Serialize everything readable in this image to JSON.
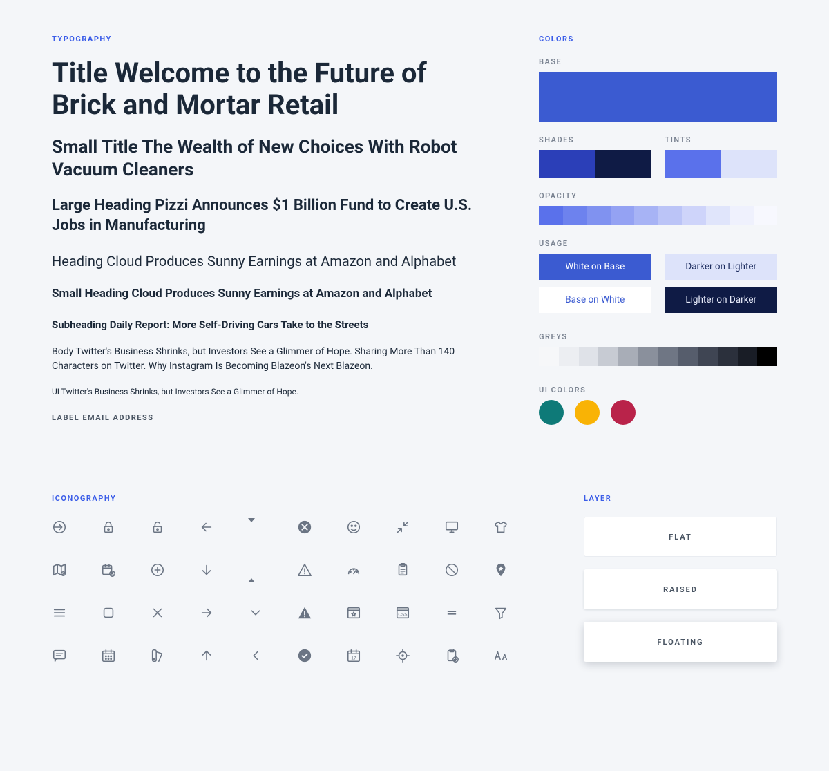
{
  "sections": {
    "typography": "TYPOGRAPHY",
    "colors": "COLORS",
    "iconography": "ICONOGRAPHY",
    "layer": "LAYER"
  },
  "typography": {
    "title": "Title Welcome to the Future of Brick and Mortar Retail",
    "stitle": "Small Title The Wealth of New Choices With Robot Vacuum Cleaners",
    "lhead": "Large Heading Pizzi Announces $1 Billion Fund to Create U.S. Jobs in Manufacturing",
    "head": "Heading Cloud Produces Sunny Earnings at Amazon and Alphabet",
    "shead": "Small Heading Cloud Produces Sunny Earnings at Amazon and Alphabet",
    "subhead": "Subheading Daily Report: More Self-Driving Cars Take to the Streets",
    "body": "Body Twitter's Business Shrinks, but Investors See a Glimmer of Hope. Sharing More Than 140 Characters on Twitter. Why Instagram Is Becoming Blazeon's Next Blazeon.",
    "ui": "UI Twitter's Business Shrinks, but Investors See a Glimmer of Hope.",
    "label": "LABEL EMAIL ADDRESS"
  },
  "colors": {
    "base_label": "BASE",
    "base": "#3b5bd1",
    "shades_label": "SHADES",
    "shades": [
      "#2b3fb8",
      "#0f1b45"
    ],
    "tints_label": "TINTS",
    "tints": [
      "#5a71eb",
      "#dde3fa"
    ],
    "opacity_label": "OPACITY",
    "opacity": [
      "#5a71eb",
      "#6d82ee",
      "#8092f0",
      "#94a2f3",
      "#a7b3f5",
      "#bbc4f7",
      "#ced4fa",
      "#e0e5fb",
      "#eff1fd",
      "#f7f8fe"
    ],
    "usage_label": "USAGE",
    "usage": [
      {
        "text": "White on Base",
        "bg": "#3b5bd1",
        "fg": "#ffffff"
      },
      {
        "text": "Darker on Lighter",
        "bg": "#dde3fa",
        "fg": "#1b2b5e"
      },
      {
        "text": "Base on White",
        "bg": "#ffffff",
        "fg": "#3b5bd1"
      },
      {
        "text": "Lighter on Darker",
        "bg": "#0f1b45",
        "fg": "#e8ecfb"
      }
    ],
    "greys_label": "GREYS",
    "greys": [
      "#f6f7f9",
      "#eceef2",
      "#dfe2e8",
      "#c7cbd3",
      "#a8adb7",
      "#8a909c",
      "#6f7684",
      "#565d6c",
      "#3f4553",
      "#2b303c",
      "#191d26",
      "#000000"
    ],
    "ui_label": "UI COLORS",
    "ui": [
      "#0e7a78",
      "#f9b305",
      "#b9234a"
    ]
  },
  "layer": {
    "flat": "FLAT",
    "raised": "RAISED",
    "floating": "FLOATING"
  }
}
